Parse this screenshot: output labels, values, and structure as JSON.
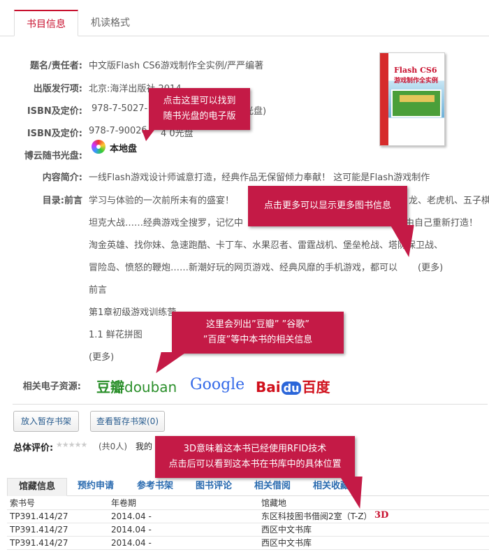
{
  "tabs": {
    "active": "书目信息",
    "inactive": "机读格式"
  },
  "fields": {
    "title_label": "题名/责任者:",
    "title_value": "中文版Flash CS6游戏制作全实例/严严编著",
    "pub_label": "出版发行项:",
    "pub_value": "北京:海洋出版社,2014",
    "isbn1_label": "ISBN及定价:",
    "isbn1_value": "978-7-5027-",
    "isbn1_value_tail": "光盘)",
    "isbn2_label": "ISBN及定价:",
    "isbn2_value": "978-7-9002б",
    "isbn2_value_tail": "4 0光盘",
    "cd_label": "博云随书光盘:",
    "cd_value": "本地盘",
    "summary_label": "内容简介:",
    "summary_text": "一线Flash游戏设计师诚意打造，经典作品无保留倾力奉献！ 这可能是Flash游戏制作",
    "toc_label": "目录:前言",
    "toc_lines": [
      "学习与体验的一次前所未有的盛宴！",
      "坦克大战……经典游戏全搜罗，记忆中",
      "淘金英雄、找你妹、急速跑酷、卡丁车、水果忍者、雷霆战机、堡垒枪战、塔防保卫战、",
      "冒险岛、愤怒的鞭炮……新潮好玩的网页游戏、经典风靡的手机游戏，都可以",
      "前言",
      " 第1章初级游戏训练营",
      "1.1 鲜花拼图",
      "(更多)"
    ],
    "toc_line1_tail": "龙、老虎机、五子棋",
    "toc_line2_tail": "由自己重新打造！",
    "toc_more_inline": "(更多)",
    "resources_label": "相关电子资源:"
  },
  "cover": {
    "title": "Flash CS6",
    "subtitle": "游戏制作全实例"
  },
  "logos": {
    "douban_cn": "豆瓣",
    "douban_en": "douban",
    "google": "Google",
    "baidu_a": "Bai",
    "baidu_b": "du",
    "baidu_c": "百度"
  },
  "buttons": {
    "add_shelf": "放入暂存书架",
    "view_shelf": "查看暂存书架(0)"
  },
  "rating": {
    "label": "总体评价:",
    "count": "(共0人)",
    "mine": "我的"
  },
  "callouts": {
    "cd": [
      "点击这里可以找到",
      "随书光盘的电子版"
    ],
    "more": [
      "点击更多可以显示更多图书信息"
    ],
    "resources": [
      "这里会列出”豆瓣” ”谷歌”",
      "”百度”等中本书的相关信息"
    ],
    "rfid": [
      "3D意味着这本书已经使用RFID技术",
      "点击后可以看到这本书在书库中的具体位置"
    ]
  },
  "bottom_tabs": [
    "馆藏信息",
    "预约申请",
    "参考书架",
    "图书评论",
    "相关借阅",
    "相关收藏"
  ],
  "holdings": {
    "headers": [
      "索书号",
      "年卷期",
      "馆藏地"
    ],
    "rows": [
      [
        "TP391.414/27",
        "2014.04 -",
        "东区科技图书借阅2室（T-Z）"
      ],
      [
        "TP391.414/27",
        "2014.04 -",
        "西区中文书库"
      ],
      [
        "TP391.414/27",
        "2014.04 -",
        "西区中文书库"
      ]
    ],
    "three_d": "3D"
  },
  "colors": {
    "accent": "#c8102e",
    "callout": "#c41a46",
    "link": "#2a6bb0"
  }
}
